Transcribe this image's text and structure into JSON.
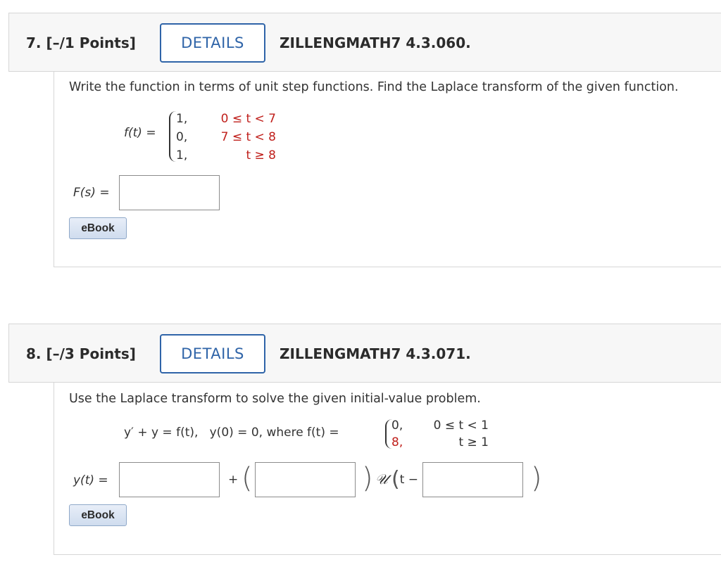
{
  "q7": {
    "number": "7. [–/1 Points]",
    "details_label": "DETAILS",
    "code": "ZILLENGMATH7 4.3.060.",
    "prompt": "Write the function in terms of unit step functions. Find the Laplace transform of the given function.",
    "f_label": "f(t)",
    "equals": "=",
    "cases": [
      {
        "value": "1,",
        "cond": "0 ≤ t < 7"
      },
      {
        "value": "0,",
        "cond": "7 ≤ t < 8"
      },
      {
        "value": "1,",
        "cond": "t ≥ 8"
      }
    ],
    "answer_label": "F(s)",
    "answer_equals": "=",
    "ebook_label": "eBook"
  },
  "q8": {
    "number": "8. [–/3 Points]",
    "details_label": "DETAILS",
    "code": "ZILLENGMATH7 4.3.071.",
    "prompt": "Use the Laplace transform to solve the given initial-value problem.",
    "ode": "y′ + y = f(t),",
    "ic": "y(0) = 0, where f(t) =",
    "cases": [
      {
        "value": "0,",
        "cond": "0 ≤ t < 1"
      },
      {
        "value": "8,",
        "cond": "t ≥ 1"
      }
    ],
    "answer_label": "y(t)",
    "answer_equals": "=",
    "plus": "+",
    "open_paren": "(",
    "close_paren": ")",
    "unit_step": "𝒰",
    "t_minus": "t −",
    "final_paren": ")",
    "ebook_label": "eBook"
  },
  "colors": {
    "accent": "#2f64a8",
    "red": "#c0201c",
    "header_bg": "#f7f7f7"
  }
}
